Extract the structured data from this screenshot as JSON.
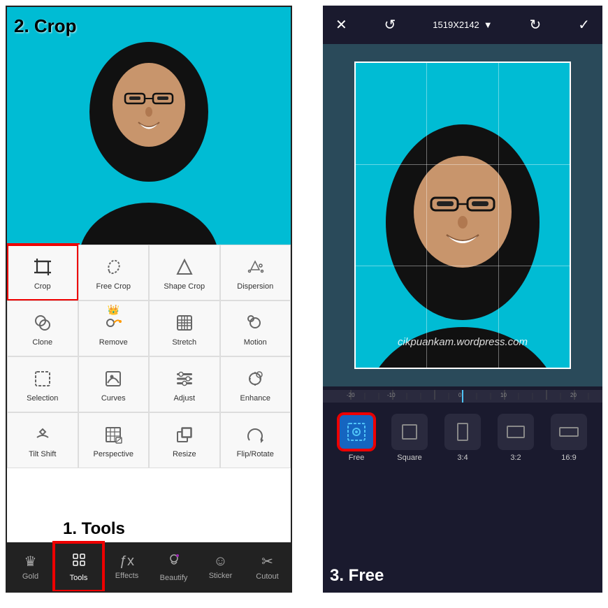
{
  "left": {
    "step_crop_label": "2. Crop",
    "step_tools_label": "1. Tools",
    "tools": [
      {
        "id": "crop",
        "label": "Crop",
        "highlighted": true
      },
      {
        "id": "free-crop",
        "label": "Free Crop",
        "highlighted": false
      },
      {
        "id": "shape-crop",
        "label": "Shape Crop",
        "highlighted": false
      },
      {
        "id": "dispersion",
        "label": "Dispersion",
        "highlighted": false
      },
      {
        "id": "clone",
        "label": "Clone",
        "highlighted": false
      },
      {
        "id": "remove",
        "label": "Remove",
        "highlighted": false,
        "crown": true
      },
      {
        "id": "stretch",
        "label": "Stretch",
        "highlighted": false
      },
      {
        "id": "motion",
        "label": "Motion",
        "highlighted": false
      },
      {
        "id": "selection",
        "label": "Selection",
        "highlighted": false
      },
      {
        "id": "curves",
        "label": "Curves",
        "highlighted": false
      },
      {
        "id": "adjust",
        "label": "Adjust",
        "highlighted": false
      },
      {
        "id": "enhance",
        "label": "Enhance",
        "highlighted": false
      },
      {
        "id": "tilt-shift",
        "label": "Tilt Shift",
        "highlighted": false
      },
      {
        "id": "perspective",
        "label": "Perspective",
        "highlighted": false
      },
      {
        "id": "resize",
        "label": "Resize",
        "highlighted": false
      },
      {
        "id": "flip-rotate",
        "label": "Flip/Rotate",
        "highlighted": false
      }
    ],
    "nav": [
      {
        "id": "gold",
        "label": "Gold"
      },
      {
        "id": "tools",
        "label": "Tools",
        "active": true
      },
      {
        "id": "effects",
        "label": "Effects"
      },
      {
        "id": "beautify",
        "label": "Beautify"
      },
      {
        "id": "sticker",
        "label": "Sticker"
      },
      {
        "id": "cutout",
        "label": "Cutout"
      }
    ]
  },
  "right": {
    "title": "1519X2142",
    "watermark": "cikpuankam.wordpress.com",
    "ruler_labels": [
      "-20",
      "-10",
      "0",
      "10",
      "20"
    ],
    "step_free_label": "3. Free",
    "crop_options": [
      {
        "id": "free",
        "label": "Free",
        "active": true
      },
      {
        "id": "square",
        "label": "Square",
        "active": false
      },
      {
        "id": "3-4",
        "label": "3:4",
        "active": false
      },
      {
        "id": "3-2",
        "label": "3:2",
        "active": false
      },
      {
        "id": "16-9",
        "label": "16:9",
        "active": false
      }
    ]
  }
}
